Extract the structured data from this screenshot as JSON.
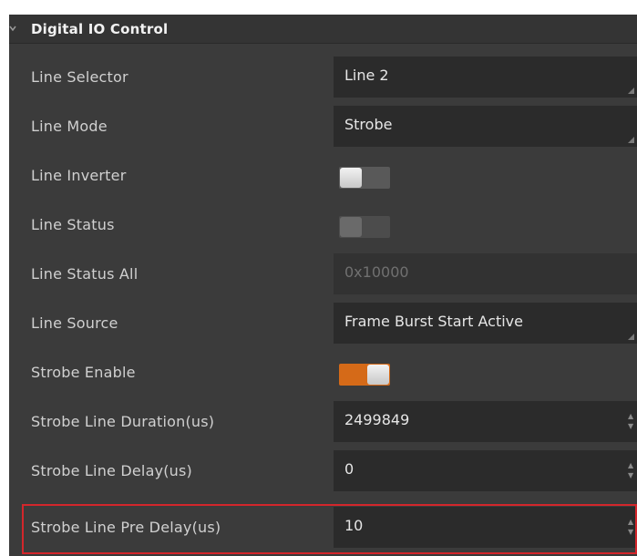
{
  "section": {
    "title": "Digital IO Control",
    "expand_icon": "chevron-down-icon"
  },
  "rows": [
    {
      "label": "Line Selector",
      "type": "combo",
      "value": "Line 2"
    },
    {
      "label": "Line Mode",
      "type": "combo",
      "value": "Strobe"
    },
    {
      "label": "Line Inverter",
      "type": "toggle",
      "state": "off"
    },
    {
      "label": "Line Status",
      "type": "toggle",
      "state": "off",
      "disabled": true
    },
    {
      "label": "Line Status All",
      "type": "text",
      "value": "0x10000",
      "disabled": true
    },
    {
      "label": "Line Source",
      "type": "combo",
      "value": "Frame Burst Start Active"
    },
    {
      "label": "Strobe Enable",
      "type": "toggle",
      "state": "on"
    },
    {
      "label": "Strobe Line Duration(us)",
      "type": "spin",
      "value": "2499849"
    },
    {
      "label": "Strobe Line Delay(us)",
      "type": "spin",
      "value": "0"
    },
    {
      "label": "Strobe Line Pre Delay(us)",
      "type": "spin",
      "value": "10",
      "highlighted": true
    }
  ],
  "colors": {
    "panel_bg": "#3b3b3b",
    "field_bg": "#2b2b2b",
    "toggle_on": "#d56a18",
    "highlight_border": "#d3262b"
  }
}
